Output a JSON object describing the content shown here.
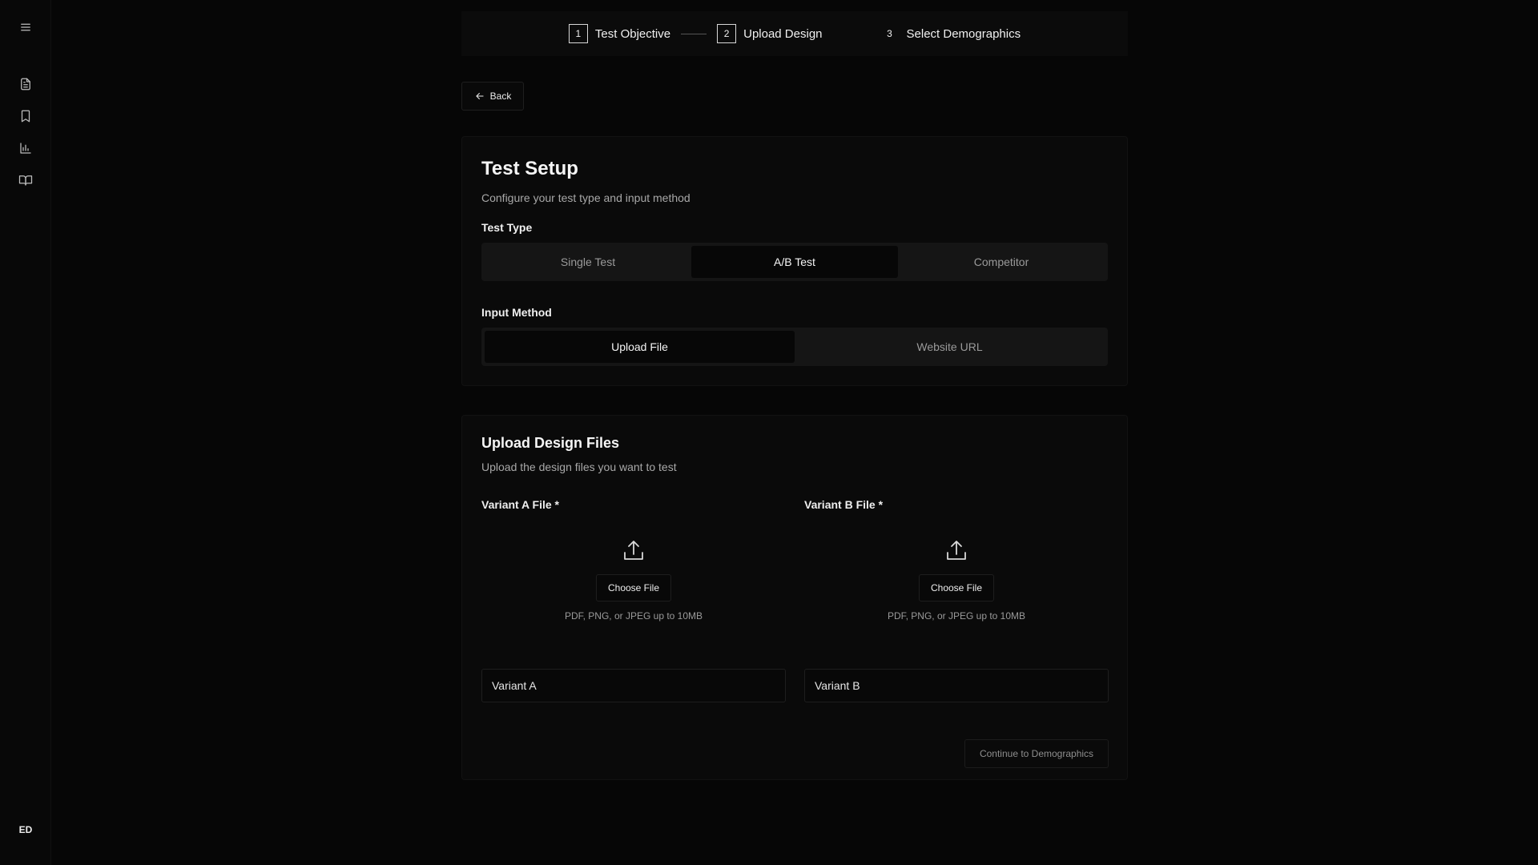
{
  "sidebar": {
    "menu_icon": "hamburger-menu-icon",
    "items": [
      {
        "name": "document-icon"
      },
      {
        "name": "bookmark-icon"
      },
      {
        "name": "bar-chart-icon"
      },
      {
        "name": "book-open-icon"
      }
    ],
    "user_initials": "ED"
  },
  "stepper": {
    "steps": [
      {
        "number": "1",
        "label": "Test Objective"
      },
      {
        "number": "2",
        "label": "Upload Design"
      },
      {
        "number": "3",
        "label": "Select Demographics"
      }
    ]
  },
  "back": {
    "label": "Back"
  },
  "setup": {
    "title": "Test Setup",
    "subtitle": "Configure your test type and input method",
    "test_type_label": "Test Type",
    "test_types": [
      "Single Test",
      "A/B Test",
      "Competitor"
    ],
    "test_type_selected": "A/B Test",
    "input_method_label": "Input Method",
    "input_methods": [
      "Upload File",
      "Website URL"
    ],
    "input_method_selected": "Upload File"
  },
  "upload": {
    "title": "Upload Design Files",
    "subtitle": "Upload the design files you want to test",
    "variant_a": {
      "label": "Variant A File *",
      "choose_label": "Choose File",
      "note": "PDF, PNG, or JPEG up to 10MB",
      "name_value": "Variant A"
    },
    "variant_b": {
      "label": "Variant B File *",
      "choose_label": "Choose File",
      "note": "PDF, PNG, or JPEG up to 10MB",
      "name_value": "Variant B"
    },
    "continue_label": "Continue to Demographics"
  }
}
